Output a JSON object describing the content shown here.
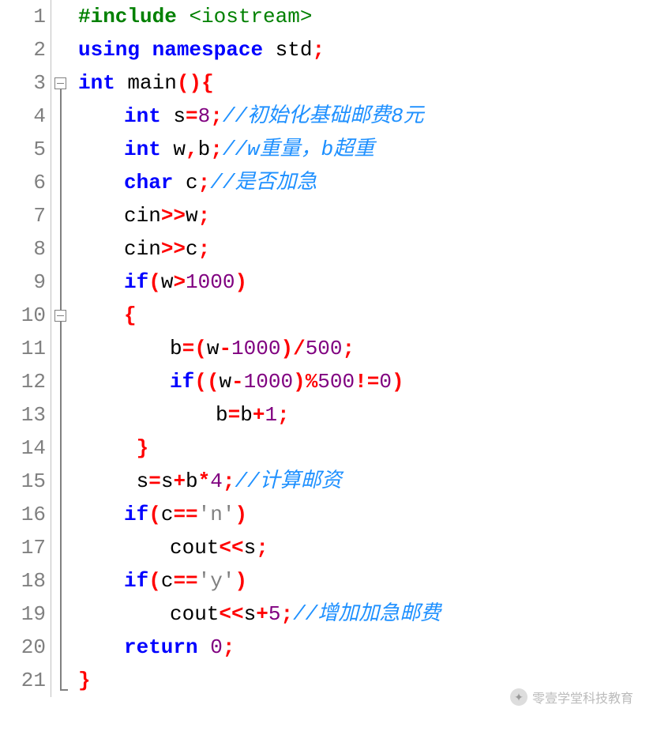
{
  "lines": {
    "n1": "1",
    "n2": "2",
    "n3": "3",
    "n4": "4",
    "n5": "5",
    "n6": "6",
    "n7": "7",
    "n8": "8",
    "n9": "9",
    "n10": "10",
    "n11": "11",
    "n12": "12",
    "n13": "13",
    "n14": "14",
    "n15": "15",
    "n16": "16",
    "n17": "17",
    "n18": "18",
    "n19": "19",
    "n20": "20",
    "n21": "21"
  },
  "tok": {
    "include": "#include",
    "iostream": "<iostream>",
    "using": "using",
    "namespace": "namespace",
    "std": "std",
    "int": "int",
    "main": "main",
    "char": "char",
    "if": "if",
    "return": "return",
    "s": "s",
    "eq": "=",
    "eight": "8",
    "semi": ";",
    "w": "w",
    "comma": ",",
    "b": "b",
    "c": "c",
    "cin": "cin",
    "rsh": ">>",
    "cout": "cout",
    "lsh": "<<",
    "gt": ">",
    "thousand": "1000",
    "lbrace": "{",
    "rbrace": "}",
    "lpar": "(",
    "rpar": ")",
    "minus": "-",
    "div": "/",
    "fivehund": "500",
    "mod": "%",
    "neq": "!=",
    "zero": "0",
    "plus": "+",
    "one": "1",
    "four": "4",
    "five": "5",
    "eqeq": "==",
    "chn": "'n'",
    "chy": "'y'",
    "sp": " "
  },
  "comments": {
    "c4": "//初始化基础邮费8元",
    "c5": "//w重量，b超重",
    "c6": "//是否加急",
    "c15": "//计算邮资",
    "c19": "//增加加急邮费"
  },
  "watermark": "零壹学堂科技教育"
}
